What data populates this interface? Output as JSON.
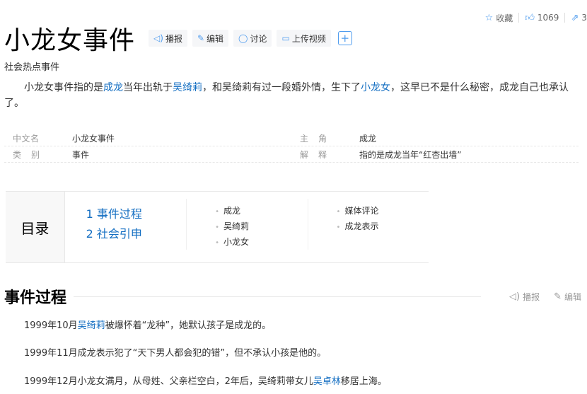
{
  "top_actions": {
    "collect_label": "收藏",
    "like_count": "1069",
    "share_count": "3"
  },
  "title": "小龙女事件",
  "title_buttons": {
    "broadcast": "播报",
    "edit": "编辑",
    "discuss": "讨论",
    "upload_video": "上传视频"
  },
  "subtitle": "社会热点事件",
  "summary": {
    "p1": "小龙女事件指的是",
    "l1": "成龙",
    "p2": "当年出轨于",
    "l2": "吴绮莉",
    "p3": "，和吴绮莉有过一段婚外情，生下了",
    "l3": "小龙女",
    "p4": "，这早已不是什么秘密，成龙自己也承认了。"
  },
  "info": {
    "k1": "中文名",
    "v1": "小龙女事件",
    "k2": "主角",
    "v2": "成龙",
    "k3": "类别",
    "v3": "事件",
    "k4": "解释",
    "v4": "指的是成龙当年“红杏出墙”"
  },
  "catalog": {
    "heading": "目录",
    "level1": [
      "1 事件过程",
      "2 社会引申"
    ],
    "col1": [
      "成龙",
      "吴绮莉",
      "小龙女"
    ],
    "col2": [
      "媒体评论",
      "成龙表示"
    ]
  },
  "section": {
    "title": "事件过程",
    "broadcast": "播报",
    "edit": "编辑"
  },
  "paragraphs": {
    "a1": "1999年10月",
    "a_link": "吴绮莉",
    "a2": "被爆怀着“龙种”，她默认孩子是成龙的。",
    "b": "1999年11月成龙表示犯了“天下男人都会犯的错”，但不承认小孩是他的。",
    "c1": "1999年12月小龙女满月，从母姓、父亲栏空白，2年后，吴绮莉带女儿",
    "c_link": "吴卓林",
    "c2": "移居上海。"
  },
  "colors": {
    "link": "#136ec2",
    "icon_blue": "#4f9cee"
  },
  "icons": [
    "star-icon",
    "thumbs-up-icon",
    "share-icon",
    "speaker-icon",
    "pencil-icon",
    "chat-bubble-icon",
    "video-icon",
    "plus-icon"
  ]
}
